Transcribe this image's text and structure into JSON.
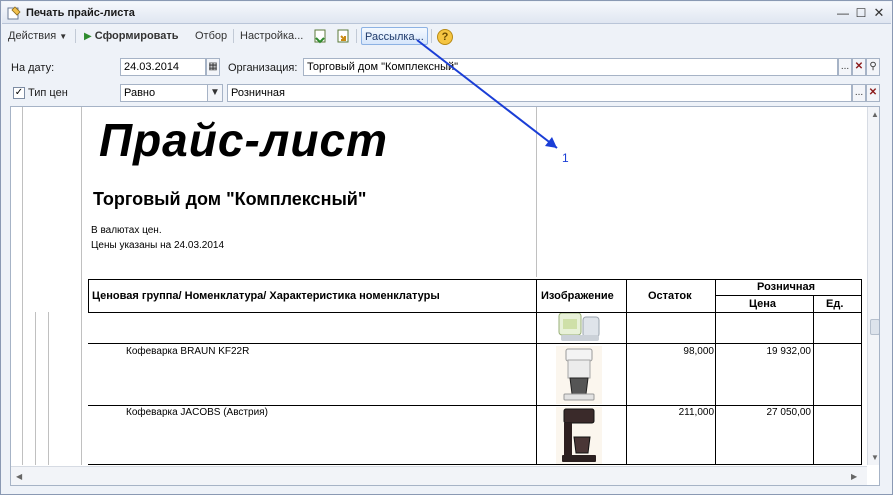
{
  "window": {
    "title": "Печать прайс-листа"
  },
  "toolbar": {
    "actions_label": "Действия",
    "generate_label": "Сформировать",
    "filter_label": "Отбор",
    "settings_label": "Настройка...",
    "mailing_label": "Рассылка...",
    "help_label": "?"
  },
  "form": {
    "date_label": "На дату:",
    "date_value": "24.03.2014",
    "org_label": "Организация:",
    "org_value": "Торговый дом \"Комплексный\"",
    "price_type_label": "Тип цен",
    "price_type_checked": true,
    "condition_value": "Равно",
    "price_type_value": "Розничная"
  },
  "report": {
    "title": "Прайс-лист",
    "company": "Торговый дом \"Комплексный\"",
    "currency_note": "В валютах цен.",
    "date_note": "Цены указаны на 24.03.2014",
    "headers": {
      "name": "Ценовая группа/ Номенклатура/ Характеристика номенклатуры",
      "image": "Изображение",
      "stock": "Остаток",
      "retail": "Розничная",
      "price": "Цена",
      "unit": "Ед."
    },
    "rows": [
      {
        "name": "Кофеварка BRAUN KF22R",
        "stock": "98,000",
        "price": "19 932,00"
      },
      {
        "name": "Кофеварка JACOBS (Австрия)",
        "stock": "211,000",
        "price": "27 050,00"
      }
    ]
  },
  "annotation": {
    "label": "1",
    "color": "#1a3ed6"
  }
}
